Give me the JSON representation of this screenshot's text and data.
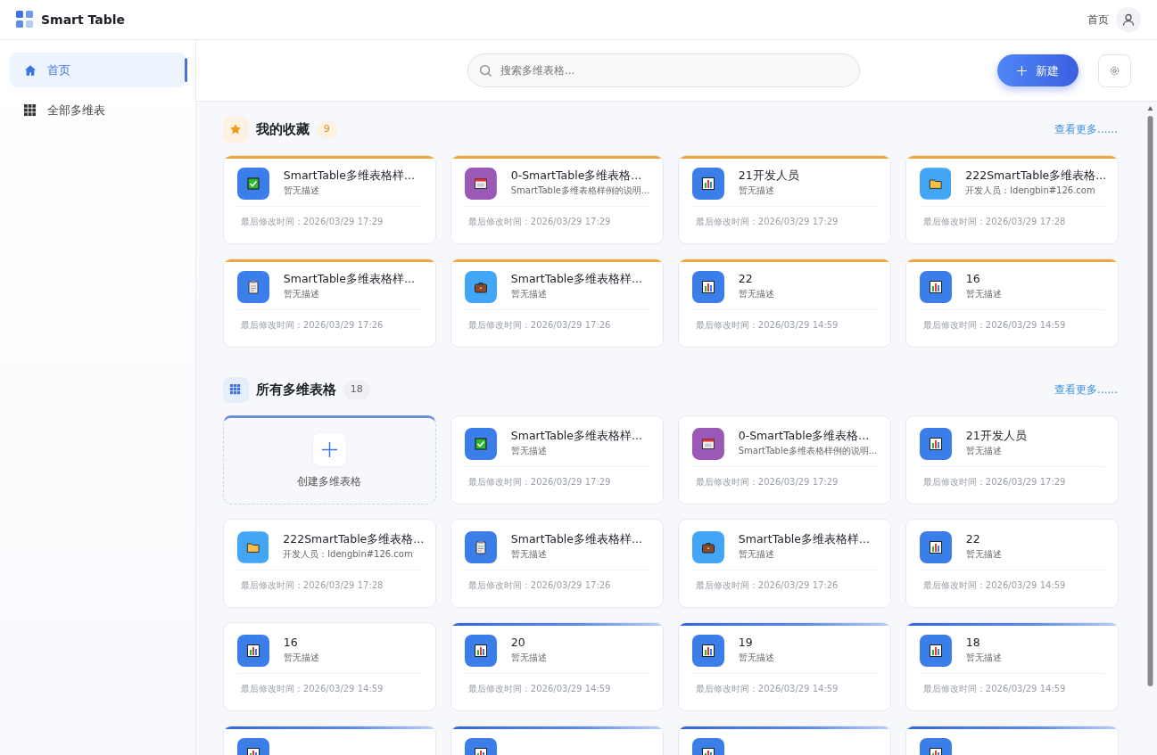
{
  "app": {
    "title": "Smart Table"
  },
  "header": {
    "home_link": "首页"
  },
  "sidebar": {
    "items": [
      {
        "label": "首页",
        "selected": true
      },
      {
        "label": "全部多维表",
        "selected": false
      }
    ]
  },
  "toolbar": {
    "search": {
      "placeholder": "搜索多维表格..."
    },
    "new_button": "新建"
  },
  "sections": [
    {
      "kind": "favorites",
      "title": "我的收藏",
      "count": "9",
      "more": "查看更多......",
      "cards": [
        {
          "title": "SmartTable多维表格样...",
          "description": "暂无描述",
          "modified": "最后修改时间：2026/03/29 17:29",
          "kind": "check",
          "highlighted": true
        },
        {
          "title": "0-SmartTable多维表格...",
          "description": "SmartTable多维表格样例的说明...",
          "modified": "最后修改时间：2026/03/29 17:29",
          "kind": "calendar",
          "highlighted": true
        },
        {
          "title": "21开发人员",
          "description": "暂无描述",
          "modified": "最后修改时间：2026/03/29 17:29",
          "kind": "chart",
          "highlighted": true
        },
        {
          "title": "222SmartTable多维表格...",
          "description": "开发人员：ldengbin#126.com",
          "modified": "最后修改时间：2026/03/29 17:28",
          "kind": "folder",
          "highlighted": true
        },
        {
          "title": "SmartTable多维表格样...",
          "description": "暂无描述",
          "modified": "最后修改时间：2026/03/29 17:26",
          "kind": "clipboard",
          "highlighted": true
        },
        {
          "title": "SmartTable多维表格样...",
          "description": "暂无描述",
          "modified": "最后修改时间：2026/03/29 17:26",
          "kind": "briefcase",
          "highlighted": true
        },
        {
          "title": "22",
          "description": "暂无描述",
          "modified": "最后修改时间：2026/03/29 14:59",
          "kind": "chart",
          "highlighted": true
        },
        {
          "title": "16",
          "description": "暂无描述",
          "modified": "最后修改时间：2026/03/29 14:59",
          "kind": "chart",
          "highlighted": true
        }
      ]
    },
    {
      "kind": "all",
      "title": "所有多维表格",
      "count": "18",
      "more": "查看更多......",
      "create_label": "创建多维表格",
      "cards": [
        {
          "title": "SmartTable多维表格样...",
          "description": "暂无描述",
          "modified": "最后修改时间：2026/03/29 17:29",
          "kind": "check",
          "highlighted": false
        },
        {
          "title": "0-SmartTable多维表格...",
          "description": "SmartTable多维表格样例的说明...",
          "modified": "最后修改时间：2026/03/29 17:29",
          "kind": "calendar",
          "highlighted": false
        },
        {
          "title": "21开发人员",
          "description": "暂无描述",
          "modified": "最后修改时间：2026/03/29 17:29",
          "kind": "chart",
          "highlighted": false
        },
        {
          "title": "222SmartTable多维表格...",
          "description": "开发人员：ldengbin#126.com",
          "modified": "最后修改时间：2026/03/29 17:28",
          "kind": "folder",
          "highlighted": false
        },
        {
          "title": "SmartTable多维表格样...",
          "description": "暂无描述",
          "modified": "最后修改时间：2026/03/29 17:26",
          "kind": "clipboard",
          "highlighted": false
        },
        {
          "title": "SmartTable多维表格样...",
          "description": "暂无描述",
          "modified": "最后修改时间：2026/03/29 17:26",
          "kind": "briefcase",
          "highlighted": false
        },
        {
          "title": "22",
          "description": "暂无描述",
          "modified": "最后修改时间：2026/03/29 14:59",
          "kind": "chart",
          "highlighted": false
        },
        {
          "title": "16",
          "description": "暂无描述",
          "modified": "最后修改时间：2026/03/29 14:59",
          "kind": "chart",
          "highlighted": false
        },
        {
          "title": "20",
          "description": "暂无描述",
          "modified": "最后修改时间：2026/03/29 14:59",
          "kind": "chart",
          "highlighted": true
        },
        {
          "title": "19",
          "description": "暂无描述",
          "modified": "最后修改时间：2026/03/29 14:59",
          "kind": "chart",
          "highlighted": true
        },
        {
          "title": "18",
          "description": "暂无描述",
          "modified": "最后修改时间：2026/03/29 14:59",
          "kind": "chart",
          "highlighted": true
        },
        {
          "kind": "chart",
          "highlighted": true
        },
        {
          "kind": "chart",
          "highlighted": true
        },
        {
          "kind": "chart",
          "highlighted": true
        },
        {
          "kind": "chart",
          "highlighted": true
        }
      ]
    }
  ]
}
